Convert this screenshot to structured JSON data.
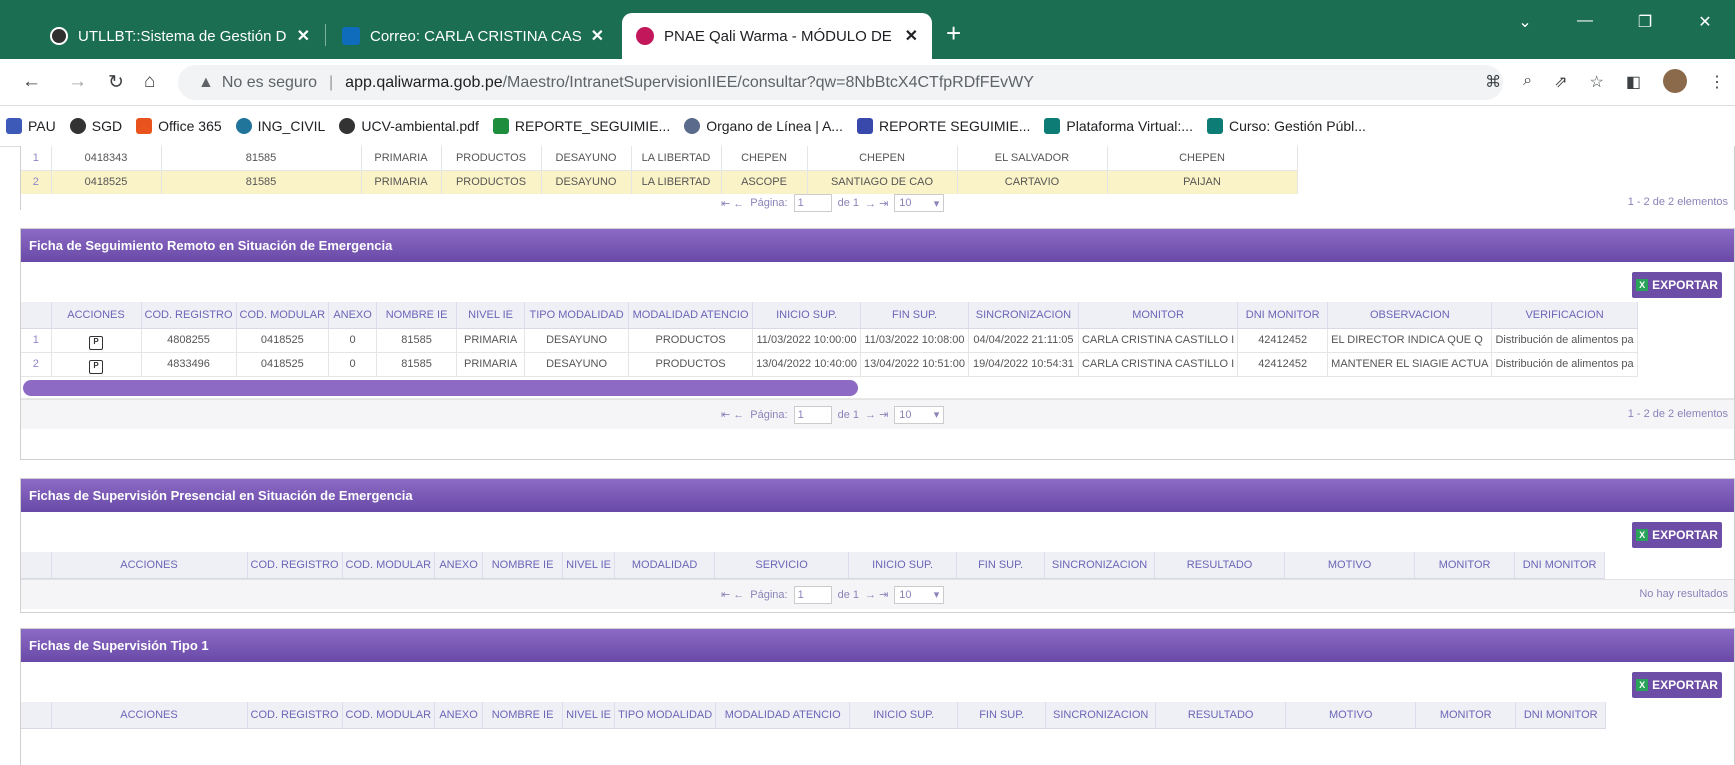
{
  "browser": {
    "tabs": [
      {
        "title": "UTLLBT::Sistema de Gestión Docu",
        "color": "#2f2f2f"
      },
      {
        "title": "Correo: CARLA CRISTINA CASTILL",
        "color": "#0f6cbd"
      },
      {
        "title": "PNAE Qali Warma - MÓDULO DE",
        "color": "#c2185b"
      }
    ],
    "new_tab": "+",
    "address": {
      "security": "No es seguro",
      "host": "app.qaliwarma.gob.pe",
      "path": "/Maestro/IntranetSupervisionIIEE/consultar?qw=8NbBtcX4CTfpRDfFEvWY"
    },
    "bookmarks": [
      {
        "label": "PAU",
        "color": "#3d5ab8"
      },
      {
        "label": "SGD",
        "color": "#333333"
      },
      {
        "label": "Office 365",
        "color": "#e8541c"
      },
      {
        "label": "ING_CIVIL",
        "color": "#21759b"
      },
      {
        "label": "UCV-ambiental.pdf",
        "color": "#333333"
      },
      {
        "label": "REPORTE_SEGUIMIE...",
        "color": "#1e8e3e"
      },
      {
        "label": "Organo de Línea | A...",
        "color": "#5a6b8c"
      },
      {
        "label": "REPORTE SEGUIMIE...",
        "color": "#3949ab"
      },
      {
        "label": "Plataforma Virtual:...",
        "color": "#0d7c74"
      },
      {
        "label": "Curso: Gestión Públ...",
        "color": "#0d7c74"
      }
    ]
  },
  "top_table": {
    "rows": [
      {
        "n": "1",
        "cod": "0418343",
        "nombre": "81585",
        "nivel": "PRIMARIA",
        "modalidad": "PRODUCTOS",
        "servicio": "DESAYUNO",
        "region": "LA LIBERTAD",
        "provincia": "CHEPEN",
        "distrito": "CHEPEN",
        "centro": "EL SALVADOR",
        "ugel": "CHEPEN"
      },
      {
        "n": "2",
        "cod": "0418525",
        "nombre": "81585",
        "nivel": "PRIMARIA",
        "modalidad": "PRODUCTOS",
        "servicio": "DESAYUNO",
        "region": "LA LIBERTAD",
        "provincia": "ASCOPE",
        "distrito": "SANTIAGO DE CAO",
        "centro": "CARTAVIO",
        "ugel": "PAIJAN"
      }
    ],
    "pager": {
      "page_label": "Página:",
      "page": "1",
      "of": "de 1",
      "size": "10",
      "summary": "1 - 2 de 2 elementos"
    }
  },
  "remote": {
    "title": "Ficha de Seguimiento Remoto en Situación de Emergencia",
    "export": "EXPORTAR",
    "headers": [
      "ACCIONES",
      "COD. REGISTRO",
      "COD. MODULAR",
      "ANEXO",
      "NOMBRE IE",
      "NIVEL IE",
      "TIPO MODALIDAD",
      "MODALIDAD ATENCIO",
      "INICIO SUP.",
      "FIN SUP.",
      "SINCRONIZACION",
      "MONITOR",
      "DNI MONITOR",
      "OBSERVACION",
      "VERIFICACION"
    ],
    "rows": [
      [
        "1",
        "4808255",
        "0418525",
        "0",
        "81585",
        "PRIMARIA",
        "DESAYUNO",
        "PRODUCTOS",
        "11/03/2022 10:00:00",
        "11/03/2022 10:08:00",
        "04/04/2022 21:11:05",
        "CARLA CRISTINA CASTILLO I",
        "42412452",
        "EL DIRECTOR INDICA QUE Q",
        "Distribución de alimentos pa"
      ],
      [
        "2",
        "4833496",
        "0418525",
        "0",
        "81585",
        "PRIMARIA",
        "DESAYUNO",
        "PRODUCTOS",
        "13/04/2022 10:40:00",
        "13/04/2022 10:51:00",
        "19/04/2022 10:54:31",
        "CARLA CRISTINA CASTILLO I",
        "42412452",
        "MANTENER EL SIAGIE ACTUA",
        "Distribución de alimentos pa"
      ]
    ],
    "pager": {
      "page_label": "Página:",
      "page": "1",
      "of": "de 1",
      "size": "10",
      "summary": "1 - 2 de 2 elementos"
    }
  },
  "presencial": {
    "title": "Fichas de Supervisión Presencial en Situación de Emergencia",
    "export": "EXPORTAR",
    "headers": [
      "ACCIONES",
      "COD. REGISTRO",
      "COD. MODULAR",
      "ANEXO",
      "NOMBRE IE",
      "NIVEL IE",
      "MODALIDAD",
      "SERVICIO",
      "INICIO SUP.",
      "FIN SUP.",
      "SINCRONIZACION",
      "RESULTADO",
      "MOTIVO",
      "MONITOR",
      "DNI MONITOR"
    ],
    "pager": {
      "page_label": "Página:",
      "page": "1",
      "of": "de 1",
      "size": "10",
      "summary": "No hay resultados"
    }
  },
  "tipo1": {
    "title": "Fichas de Supervisión Tipo 1",
    "export": "EXPORTAR",
    "headers": [
      "ACCIONES",
      "COD. REGISTRO",
      "COD. MODULAR",
      "ANEXO",
      "NOMBRE IE",
      "NIVEL IE",
      "TIPO MODALIDAD",
      "MODALIDAD ATENCIO",
      "INICIO SUP.",
      "FIN SUP.",
      "SINCRONIZACION",
      "RESULTADO",
      "MOTIVO",
      "MONITOR",
      "DNI MONITOR"
    ]
  }
}
